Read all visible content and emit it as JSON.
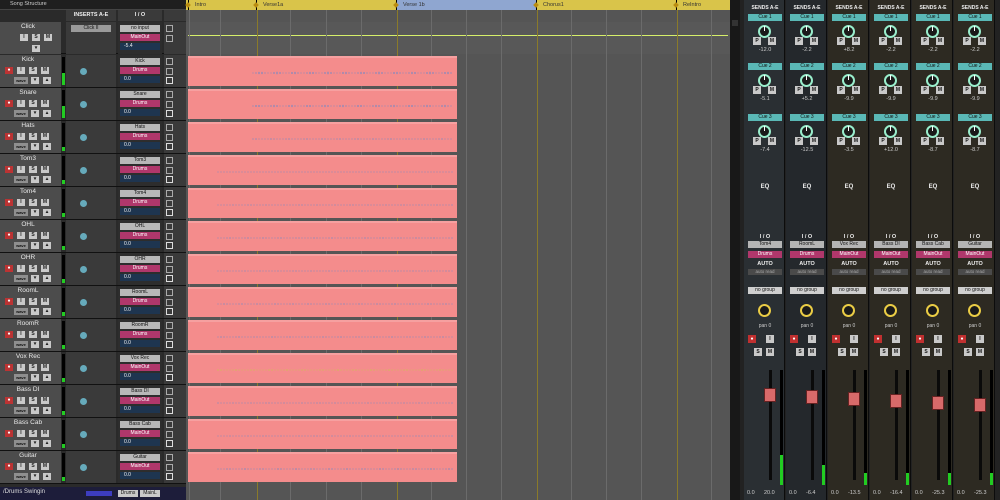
{
  "left_panel": {
    "header_title": "Song Structure",
    "col_inserts": "INSERTS A-E",
    "col_io": "I / O"
  },
  "tracks": [
    {
      "name": "Kick",
      "input": "Kick",
      "output": "Drums",
      "vol": "0.0",
      "color": "#f48c8c"
    },
    {
      "name": "Snare",
      "input": "Snare",
      "output": "Drums",
      "vol": "0.0",
      "color": "#f48c8c"
    },
    {
      "name": "Hats",
      "input": "Hats",
      "output": "Drums",
      "vol": "0.0",
      "color": "#f48c8c"
    },
    {
      "name": "Tom3",
      "input": "Tom3",
      "output": "Drums",
      "vol": "0.0",
      "color": "#f48c8c"
    },
    {
      "name": "Tom4",
      "input": "Tom4",
      "output": "Drums",
      "vol": "0.0",
      "color": "#f48c8c"
    },
    {
      "name": "OHL",
      "input": "OHL",
      "output": "Drums",
      "vol": "0.0",
      "color": "#f48c8c"
    },
    {
      "name": "OHR",
      "input": "OHR",
      "output": "Drums",
      "vol": "0.0",
      "color": "#f48c8c"
    },
    {
      "name": "RoomL",
      "input": "RoomL",
      "output": "Drums",
      "vol": "0.0",
      "color": "#f48c8c"
    },
    {
      "name": "RoomR",
      "input": "RoomR",
      "output": "Drums",
      "vol": "0.0",
      "color": "#f48c8c"
    },
    {
      "name": "Vox Rec",
      "input": "Vox Rec",
      "output": "MainOut",
      "vol": "0.0",
      "color": "#f48c8c"
    },
    {
      "name": "Bass DI",
      "input": "Bass DI",
      "output": "MainOut",
      "vol": "0.0",
      "color": "#f48c8c"
    },
    {
      "name": "Bass Cab",
      "input": "Bass Cab",
      "output": "MainOut",
      "vol": "0.0",
      "color": "#f48c8c"
    },
    {
      "name": "Guitar",
      "input": "Guitar",
      "output": "MainOut",
      "vol": "0.0",
      "color": "#f48c8c"
    }
  ],
  "click_track": {
    "name": "Click",
    "insert": "Click II",
    "input": "no input",
    "output": "MainOut",
    "vol": "-5.4"
  },
  "button_labels": {
    "record": "●",
    "input": "I",
    "solo": "S",
    "mute": "M",
    "wave": "wave"
  },
  "bottom_track": {
    "name": "/Drums Swingin",
    "in": "Drums",
    "out": "MainL"
  },
  "markers": [
    {
      "label": "Intro"
    },
    {
      "label": "Verse1a"
    },
    {
      "label": "Verse 1b"
    },
    {
      "label": "Chorus1"
    },
    {
      "label": "ReIntro"
    }
  ],
  "mixer": {
    "sends_header": "SENDS A-E",
    "strips": [
      {
        "send1": "Cue 1",
        "send1_val": "-12.0",
        "send2": "Cue 2",
        "send2_val": "-5.1",
        "send3": "Cue 3",
        "send3_val": "-7.4",
        "in": "Tom4",
        "out": "Drums",
        "pan": "pan 0",
        "fader": "0.0",
        "peak": "20.0",
        "left_val": "8.4"
      },
      {
        "send1": "Cue 1",
        "send1_val": "-2.2",
        "send2": "Cue 2",
        "send2_val": "+5.2",
        "send3": "Cue 3",
        "send3_val": "-12.5",
        "in": "RoomL",
        "out": "Drums",
        "pan": "pan 0",
        "fader": "0.0",
        "peak": "-6.4",
        "left_val": ""
      },
      {
        "send1": "Cue 1",
        "send1_val": "+8.2",
        "send2": "Cue 2",
        "send2_val": "-9.9",
        "send3": "Cue 3",
        "send3_val": "-3.5",
        "in": "Vox Rec",
        "out": "MainOut",
        "pan": "pan 0",
        "fader": "0.0",
        "peak": "-13.5",
        "left_val": ""
      },
      {
        "send1": "Cue 1",
        "send1_val": "-2.2",
        "send2": "Cue 2",
        "send2_val": "-9.9",
        "send3": "Cue 3",
        "send3_val": "+12.0",
        "in": "Bass DI",
        "out": "MainOut",
        "pan": "pan 0",
        "fader": "0.0",
        "peak": "-16.4",
        "left_val": ""
      },
      {
        "send1": "Cue 1",
        "send1_val": "-2.2",
        "send2": "Cue 2",
        "send2_val": "-9.9",
        "send3": "Cue 3",
        "send3_val": "-8.7",
        "in": "Bass Cab",
        "out": "MainOut",
        "pan": "pan 0",
        "fader": "0.0",
        "peak": "-25.3",
        "left_val": ""
      },
      {
        "send1": "Cue 1",
        "send1_val": "-2.2",
        "send2": "Cue 2",
        "send2_val": "-9.9",
        "send3": "Cue 3",
        "send3_val": "-8.7",
        "in": "Guitar",
        "out": "MainOut",
        "pan": "pan 0",
        "fader": "0.0",
        "peak": "-25.3",
        "left_val": ""
      }
    ],
    "eq_label": "EQ",
    "io_label": "I / O",
    "auto_label": "AUTO",
    "auto_read": "auto read",
    "group_label": "no group"
  },
  "colors": {
    "clip": "#f48c8c",
    "ruler": "#d9c44a",
    "send": "#5ab8b6",
    "output": "#b0376b"
  }
}
